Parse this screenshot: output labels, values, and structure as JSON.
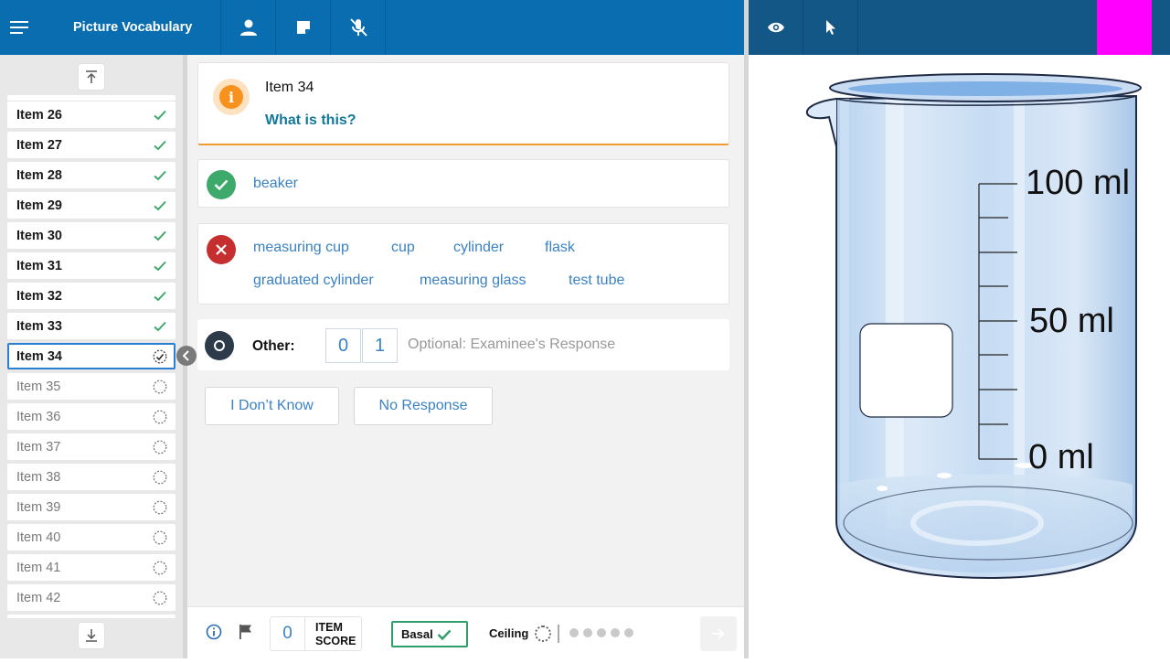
{
  "app": {
    "title": "Picture Vocabulary",
    "accent": "#0a6db0",
    "header_right_color": "#125786",
    "marker_color": "#ff00ff"
  },
  "toolbar": {
    "left_icons": [
      "menu-icon",
      "person-icon",
      "note-icon",
      "mic-off-icon"
    ],
    "right_icons": [
      "eye-icon",
      "pointer-icon"
    ]
  },
  "sidebar": {
    "items": [
      {
        "label": "Item 26",
        "status": "done"
      },
      {
        "label": "Item 27",
        "status": "done"
      },
      {
        "label": "Item 28",
        "status": "done"
      },
      {
        "label": "Item 29",
        "status": "done"
      },
      {
        "label": "Item 30",
        "status": "done"
      },
      {
        "label": "Item 31",
        "status": "done"
      },
      {
        "label": "Item 32",
        "status": "done"
      },
      {
        "label": "Item 33",
        "status": "done"
      },
      {
        "label": "Item 34",
        "status": "current"
      },
      {
        "label": "Item 35",
        "status": "pending"
      },
      {
        "label": "Item 36",
        "status": "pending"
      },
      {
        "label": "Item 37",
        "status": "pending"
      },
      {
        "label": "Item 38",
        "status": "pending"
      },
      {
        "label": "Item 39",
        "status": "pending"
      },
      {
        "label": "Item 40",
        "status": "pending"
      },
      {
        "label": "Item 41",
        "status": "pending"
      },
      {
        "label": "Item 42",
        "status": "pending"
      }
    ]
  },
  "question": {
    "item_number": "Item 34",
    "prompt": "What is this?"
  },
  "correct_responses": [
    "beaker"
  ],
  "incorrect_responses": [
    "measuring cup",
    "cup",
    "cylinder",
    "flask",
    "graduated cylinder",
    "measuring glass",
    "test tube"
  ],
  "other": {
    "label": "Other:",
    "score_options": [
      "0",
      "1"
    ],
    "placeholder": "Optional: Examinee's Response"
  },
  "buttons": {
    "dont_know": "I Don’t Know",
    "no_response": "No Response"
  },
  "footer": {
    "item_score_value": "0",
    "item_score_label_1": "ITEM",
    "item_score_label_2": "SCORE",
    "basal_label": "Basal",
    "ceiling_label": "Ceiling",
    "ceiling_dots": 5
  },
  "stimulus": {
    "labels": [
      "100 ml",
      "50 ml",
      "0 ml"
    ]
  }
}
